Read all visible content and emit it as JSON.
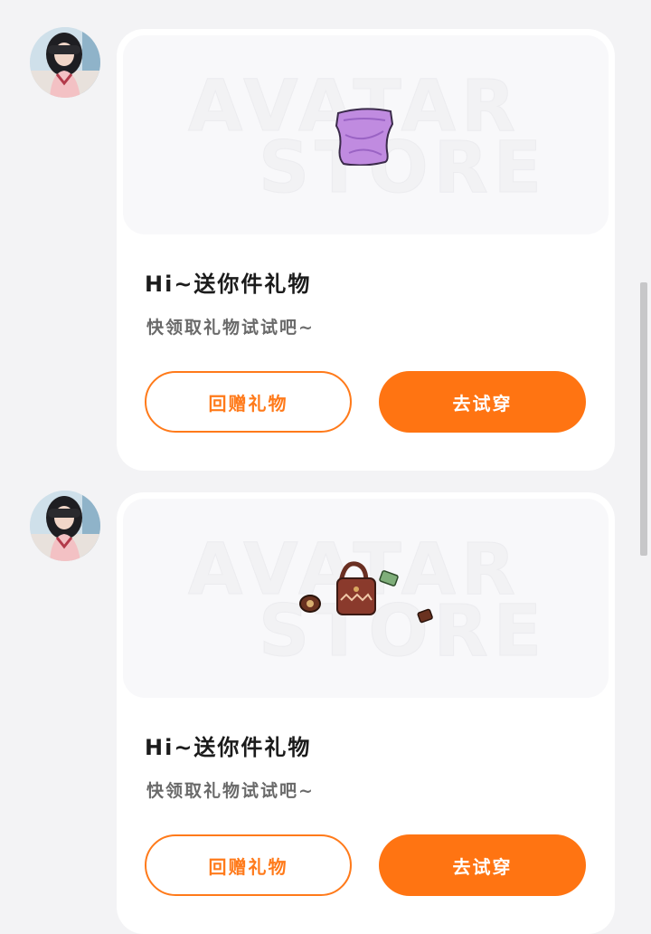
{
  "messages": [
    {
      "card": {
        "watermark_line1": "AVATAR",
        "watermark_line2": "STORE",
        "item_icon": "purple-tube-top-icon",
        "title": "Hi~送你件礼物",
        "subtitle": "快领取礼物试试吧~",
        "gift_back_label": "回赠礼物",
        "try_on_label": "去试穿"
      }
    },
    {
      "card": {
        "watermark_line1": "AVATAR",
        "watermark_line2": "STORE",
        "item_icon": "brown-handbag-set-icon",
        "title": "Hi~送你件礼物",
        "subtitle": "快领取礼物试试吧~",
        "gift_back_label": "回赠礼物",
        "try_on_label": "去试穿"
      }
    }
  ],
  "colors": {
    "accent": "#ff7412",
    "background": "#f3f3f5",
    "card": "#ffffff"
  }
}
